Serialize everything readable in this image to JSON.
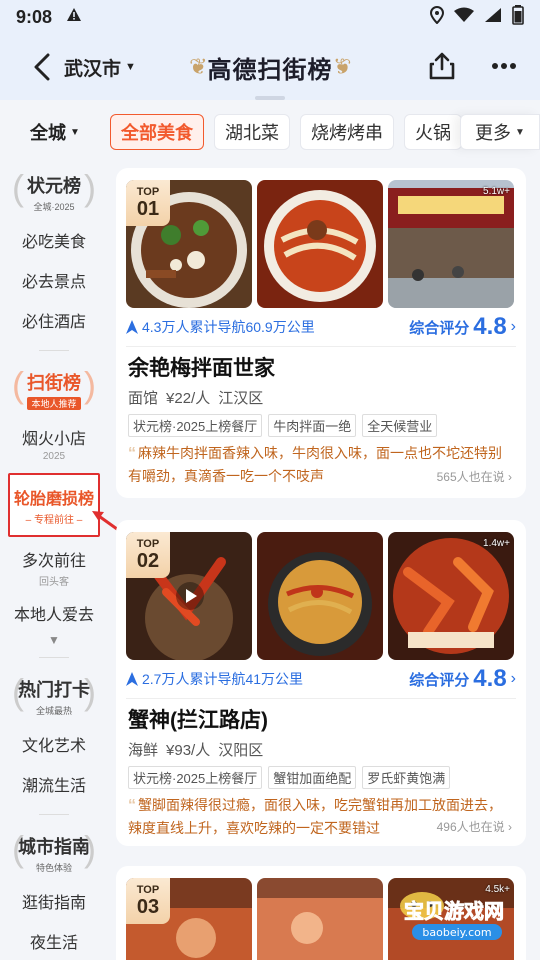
{
  "status": {
    "time": "9:08"
  },
  "header": {
    "city": "武汉市",
    "title": "高德扫街榜"
  },
  "categories": {
    "city_filter": "全城",
    "chips": [
      "全部美食",
      "湖北菜",
      "烧烤烤串",
      "火锅"
    ],
    "more": "更多"
  },
  "sidebar": {
    "groups": [
      {
        "title": "状元榜",
        "subtitle": "全城·2025",
        "items": [
          "必吃美食",
          "必去景点",
          "必住酒店"
        ]
      },
      {
        "title": "扫街榜",
        "subtitle": "本地人推荐",
        "items": [
          {
            "label": "烟火小店",
            "small": "2025"
          },
          {
            "label": "轮胎磨损榜",
            "small": "– 专程前往 –"
          },
          {
            "label": "多次前往",
            "small": "回头客"
          },
          {
            "label": "本地人爱去"
          }
        ]
      },
      {
        "title": "热门打卡",
        "subtitle": "全城最热",
        "items": [
          "文化艺术",
          "潮流生活"
        ]
      },
      {
        "title": "城市指南",
        "subtitle": "特色体验",
        "items": [
          "逛街指南",
          "夜生活"
        ]
      }
    ]
  },
  "cards": [
    {
      "rank_label": "TOP",
      "rank": "01",
      "views": "5.1w+",
      "nav_info": "4.3万人累计导航60.9万公里",
      "rating_label": "综合评分",
      "score": "4.8",
      "name": "余艳梅拌面世家",
      "category": "面馆",
      "price": "¥22/人",
      "district": "江汉区",
      "tags": [
        "状元榜·2025上榜餐厅",
        "牛肉拌面一绝",
        "全天候营业"
      ],
      "review": "麻辣牛肉拌面香辣入味，牛肉很入味，面一点也不坨还特别有嚼劲，真滴香一吃一个不吱声",
      "saying": "565人也在说"
    },
    {
      "rank_label": "TOP",
      "rank": "02",
      "views": "1.4w+",
      "nav_info": "2.7万人累计导航41万公里",
      "rating_label": "综合评分",
      "score": "4.8",
      "name": "蟹神(拦江路店)",
      "category": "海鲜",
      "price": "¥93/人",
      "district": "汉阳区",
      "tags": [
        "状元榜·2025上榜餐厅",
        "蟹钳加面绝配",
        "罗氏虾黄饱满"
      ],
      "review": "蟹脚面辣得很过瘾，面很入味，吃完蟹钳再加工放面进去，辣度直线上升，喜欢吃辣的一定不要错过",
      "saying": "496人也在说"
    },
    {
      "rank_label": "TOP",
      "rank": "03",
      "views": "4.5k+"
    }
  ],
  "watermark": {
    "title": "宝贝游戏网",
    "url": "baobeiy.com"
  },
  "colors": {
    "accent": "#f25a2e",
    "blue": "#2b6ee0",
    "highlight_box": "#e02f2f"
  }
}
